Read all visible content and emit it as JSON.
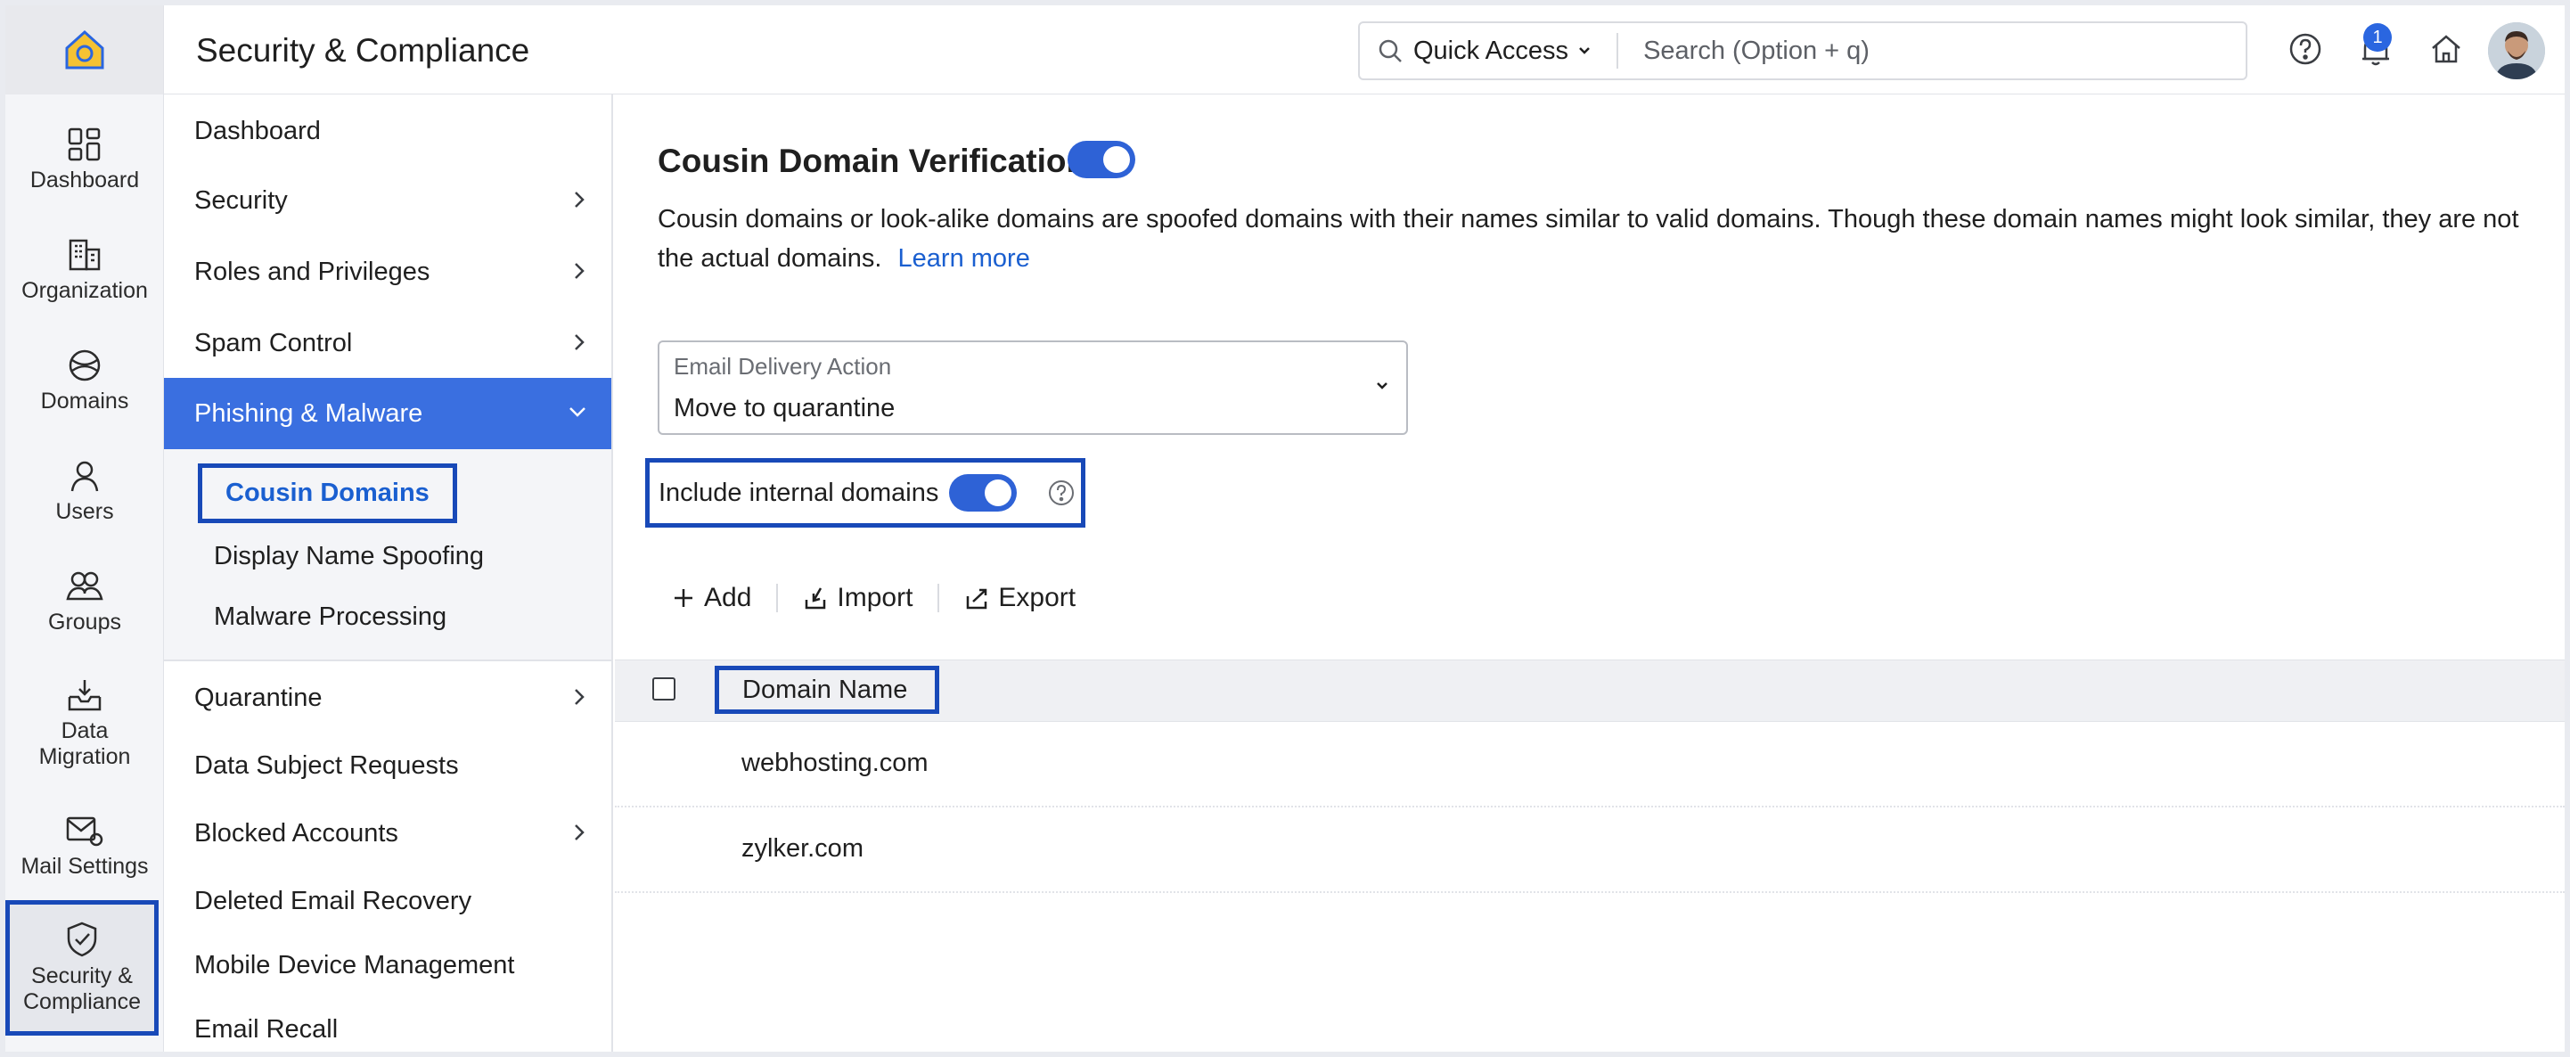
{
  "app": {
    "title": "Security & Compliance"
  },
  "header": {
    "quick_access_label": "Quick Access",
    "search_placeholder": "Search (Option + q)",
    "notification_count": "1"
  },
  "rail": {
    "items": [
      {
        "label": "Dashboard",
        "icon": "dashboard-icon"
      },
      {
        "label": "Organization",
        "icon": "organization-icon"
      },
      {
        "label": "Domains",
        "icon": "globe-icon"
      },
      {
        "label": "Users",
        "icon": "user-icon"
      },
      {
        "label": "Groups",
        "icon": "group-icon"
      },
      {
        "label": "Data Migration",
        "icon": "data-migration-icon"
      },
      {
        "label": "Mail Settings",
        "icon": "mail-settings-icon"
      },
      {
        "label": "Security & Compliance",
        "icon": "shield-check-icon"
      }
    ]
  },
  "menu": {
    "items": [
      {
        "label": "Dashboard"
      },
      {
        "label": "Security"
      },
      {
        "label": "Roles and Privileges"
      },
      {
        "label": "Spam Control"
      },
      {
        "label": "Phishing & Malware"
      },
      {
        "label": "Quarantine"
      },
      {
        "label": "Data Subject Requests"
      },
      {
        "label": "Blocked Accounts"
      },
      {
        "label": "Deleted Email Recovery"
      },
      {
        "label": "Mobile Device Management"
      },
      {
        "label": "Email Recall"
      }
    ],
    "submenu": [
      {
        "label": "Cousin Domains"
      },
      {
        "label": "Display Name Spoofing"
      },
      {
        "label": "Malware Processing"
      }
    ]
  },
  "main": {
    "title": "Cousin Domain Verification",
    "description": "Cousin domains or look-alike domains are spoofed domains with their names similar to valid domains. Though these domain names might look similar, they are not the actual domains.",
    "learn_more": "Learn more",
    "delivery_action_label": "Email Delivery Action",
    "delivery_action_value": "Move to quarantine",
    "include_internal_label": "Include internal domains",
    "toolbar": {
      "add": "Add",
      "import": "Import",
      "export": "Export"
    },
    "table": {
      "column": "Domain Name",
      "rows": [
        "webhosting.com",
        "zylker.com"
      ]
    }
  },
  "colors": {
    "accent": "#3a6fe0",
    "highlight_border": "#1849b8",
    "link": "#1a5fd0"
  }
}
